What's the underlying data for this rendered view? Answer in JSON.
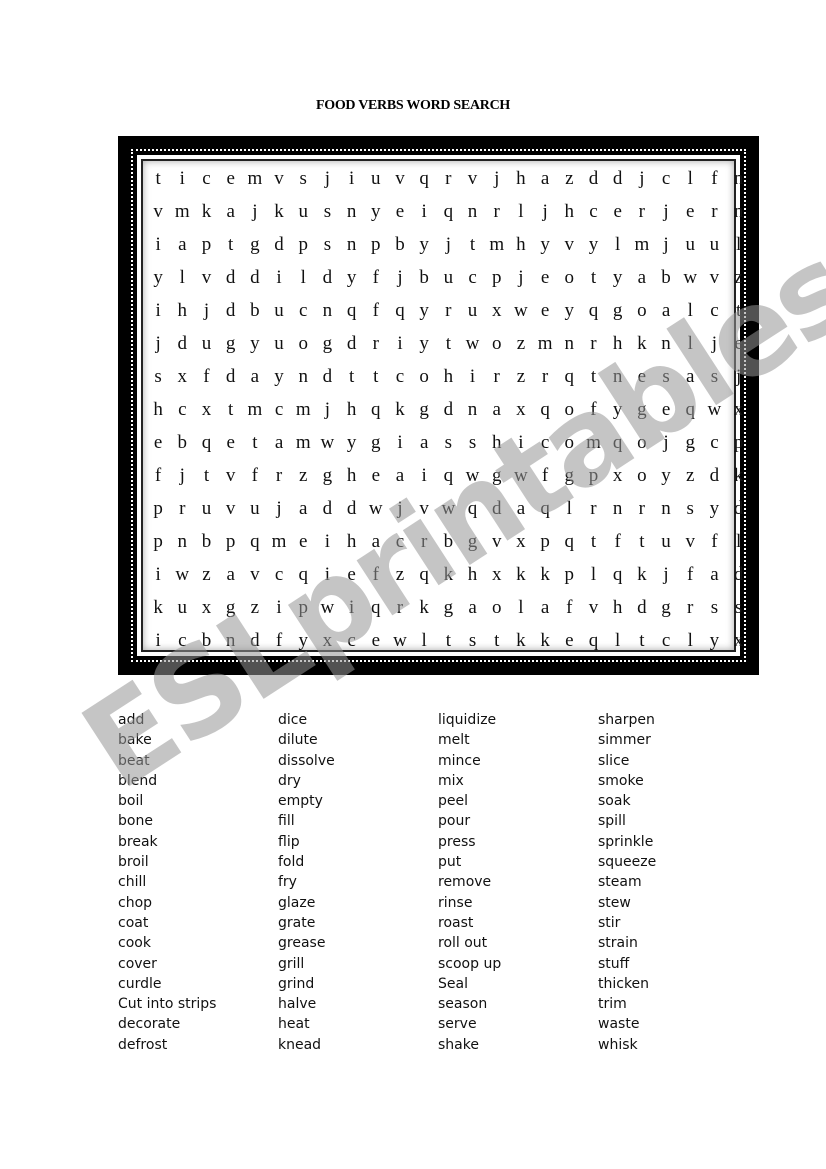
{
  "title": "FOOD VERBS WORD SEARCH",
  "grid": [
    "ticemvsjiuvqrvjhazddjclfn",
    "vmkajkusnyeiqnrljhcerjern",
    "iaptgdpsnpbyjtmhyvylmjuul",
    "ylvddildyfjbucpjeotyabwvz",
    "ihjdbucnqfqyruxweyqgoalct",
    "jdugyuogdriytwozmnrhknlje",
    "sxfdayndttcohirzrqtnesasj",
    "hcxtmcmjhqkgdnaxqofygeqwx",
    "ebqetamwygiasshicomqojgcp",
    "fjtvfrzgheaiqwgwfgpxoyzdk",
    "pruvujaddwjvwqdaqlrnrnsyd",
    "pnbpqmeihacrbgvxpqtftuvfl",
    "iwzavcqiefzqkhxkkplqkjfad",
    "kuxgzipwiqrkgaolafvhdgrss",
    "icbndfyxcewltstkkeqltclyx"
  ],
  "word_columns": [
    [
      "add",
      "bake",
      "beat",
      "blend",
      "boil",
      "bone",
      "break",
      "broil",
      "chill",
      "chop",
      "coat",
      "cook",
      "cover",
      "curdle",
      "Cut into strips",
      "decorate",
      "defrost"
    ],
    [
      "dice",
      "dilute",
      "dissolve",
      "dry",
      "empty",
      "fill",
      "flip",
      "fold",
      "fry",
      "glaze",
      "grate",
      "grease",
      "grill",
      "grind",
      "halve",
      "heat",
      "knead"
    ],
    [
      "liquidize",
      "melt",
      "mince",
      "mix",
      "peel",
      "pour",
      "press",
      "put",
      "remove",
      "rinse",
      "roast",
      "roll out",
      "scoop up",
      "Seal",
      "season",
      "serve",
      "shake"
    ],
    [
      "sharpen",
      "simmer",
      "slice",
      "smoke",
      "soak",
      "spill",
      "sprinkle",
      "squeeze",
      "steam",
      "stew",
      "stir",
      "strain",
      "stuff",
      "thicken",
      "trim",
      "waste",
      "whisk"
    ]
  ],
  "watermark": "ESLprintables.com"
}
